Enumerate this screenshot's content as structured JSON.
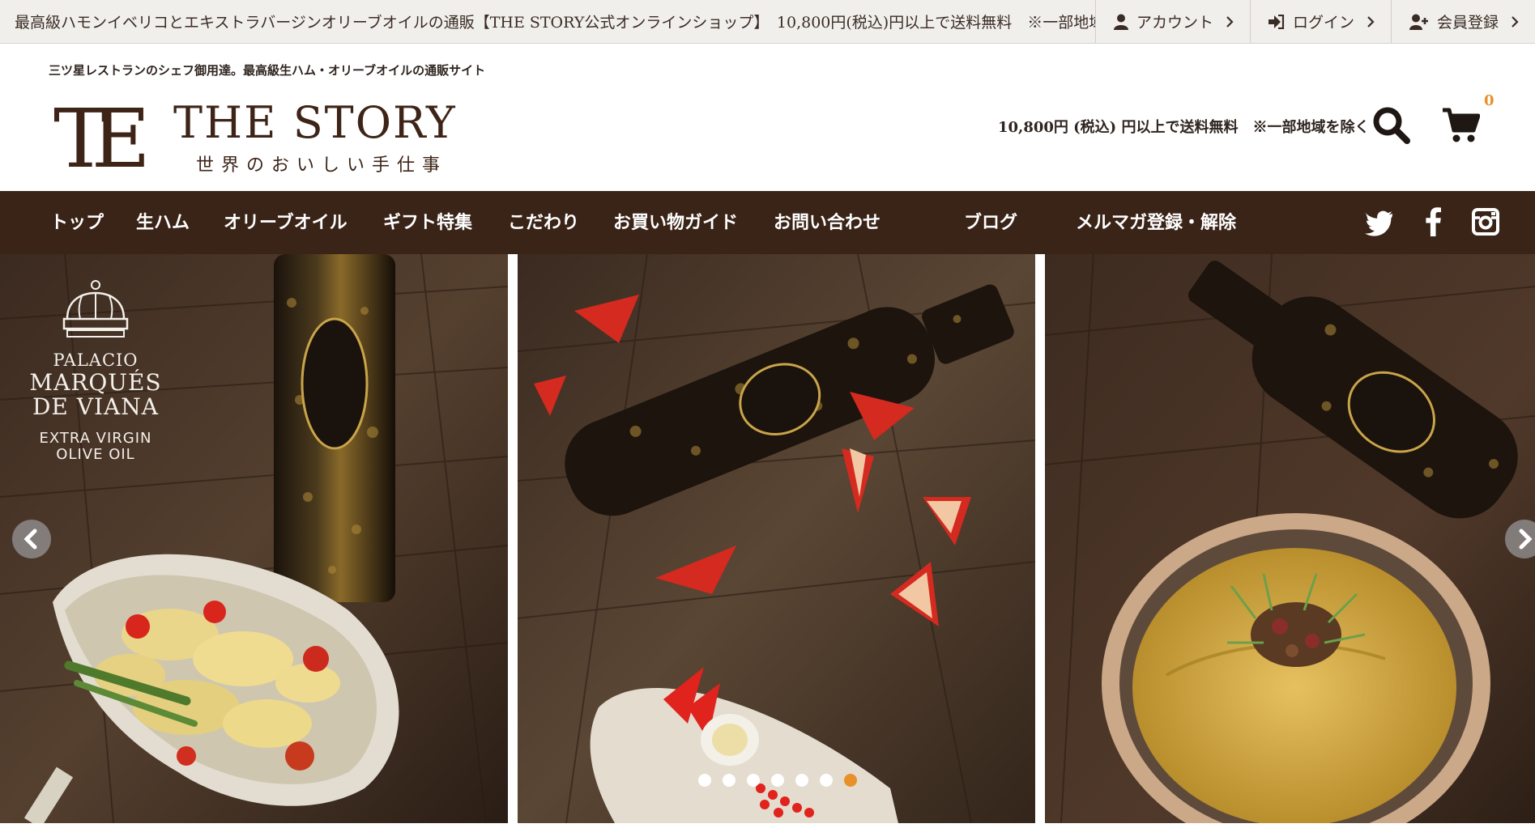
{
  "topbar": {
    "announcement": "最高級ハモンイベリコとエキストラバージンオリーブオイルの通販【THE STORY公式オンラインショップ】　10,800円(税込)円以上で送料無料　※一部地域を除く",
    "links": [
      {
        "label": "アカウント",
        "icon": "user-icon"
      },
      {
        "label": "ログイン",
        "icon": "sign-in-icon"
      },
      {
        "label": "会員登録",
        "icon": "user-plus-icon"
      }
    ]
  },
  "header": {
    "tagline": "三ツ星レストランのシェフ御用達。最高級生ハム・オリーブオイルの通販サイト",
    "logo_mark": "TE",
    "logo_title": "THE STORY",
    "logo_subtitle": "世界のおいしい手仕事",
    "shipping_notice": "10,800円 (税込) 円以上で送料無料　※一部地域を除く",
    "cart_count": "0"
  },
  "nav": {
    "items": [
      "トップ",
      "生ハム",
      "オリーブオイル",
      "ギフト特集",
      "こだわり",
      "お買い物ガイド",
      "お問い合わせ",
      "ブログ",
      "メルマガ登録・解除"
    ],
    "social": [
      "twitter-icon",
      "facebook-icon",
      "instagram-icon"
    ]
  },
  "slider": {
    "brand": {
      "line1": "PALACIO",
      "line2": "MARQUÉS",
      "line3": "DE VIANA",
      "sub1": "EXTRA VIRGIN",
      "sub2": "OLIVE OIL"
    },
    "dots_total": 7,
    "active_dot": 7
  },
  "colors": {
    "nav_bg": "#3a2418",
    "accent": "#e8912a",
    "topbar_bg": "#f1efec"
  }
}
